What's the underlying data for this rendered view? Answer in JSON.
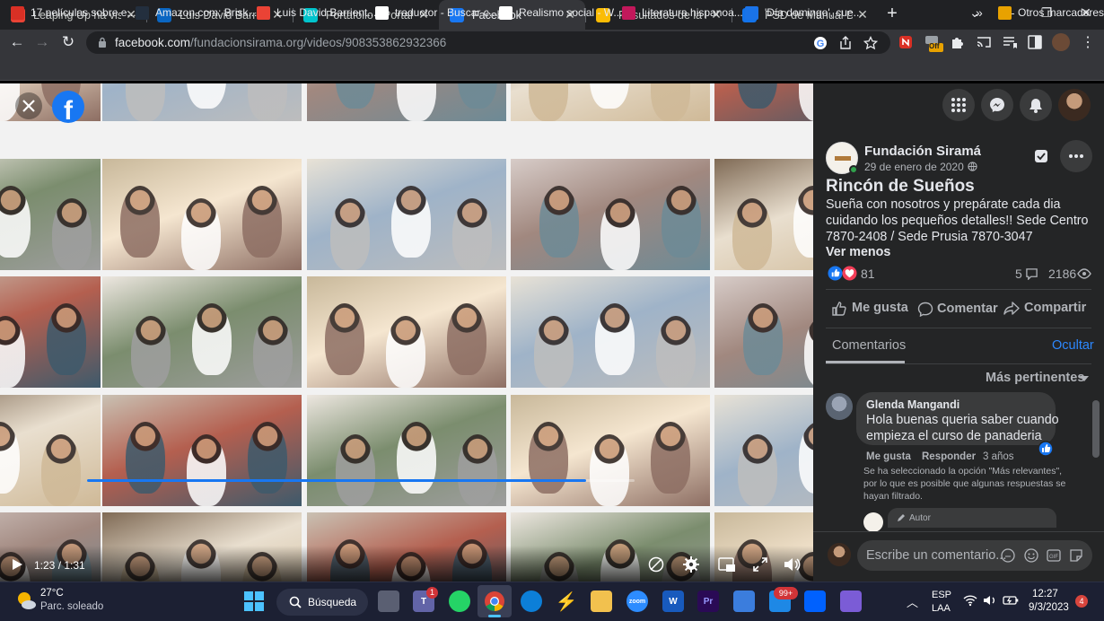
{
  "browser": {
    "tabs": [
      {
        "title": "Leaping Up ha visto tu",
        "favicon": "gmail-icon",
        "color": "#ea4335",
        "active": false
      },
      {
        "title": "Luis David Barrientos",
        "favicon": "linkedin-icon",
        "color": "#0a66c2",
        "active": false
      },
      {
        "title": "Portafolio - Portafolio",
        "favicon": "canva-icon",
        "color": "#00c4cc",
        "active": false
      },
      {
        "title": "Facebook",
        "favicon": "facebook-icon",
        "color": "#1877f2",
        "active": true
      },
      {
        "title": "Resultados de la búsq",
        "favicon": "drive-icon",
        "color": "#fbbc04",
        "active": false
      },
      {
        "title": "PSD de Manual De Ma",
        "favicon": "freepik-icon",
        "color": "#1273eb",
        "active": false
      }
    ],
    "url_host": "facebook.com",
    "url_path": "/fundacionsirama.org/videos/908353862932366",
    "bookmarks": [
      {
        "label": "17 películas sobre e...",
        "icon": "bookmark-red-icon",
        "color": "#d93025"
      },
      {
        "label": "Amazon.com: Brisk...",
        "icon": "amazon-icon",
        "color": "#232f3e"
      },
      {
        "label": "Luis David Barrient...",
        "icon": "gmail-icon",
        "color": "#ea4335"
      },
      {
        "label": "traductor - Buscar c...",
        "icon": "google-icon",
        "color": "#ffffff"
      },
      {
        "label": "Realismo social - W...",
        "icon": "wikipedia-icon",
        "color": "#ffffff"
      },
      {
        "label": "Literatura hispanoa...",
        "icon": "literature-icon",
        "color": "#c2185b"
      },
      {
        "label": "'Día domingo', cue...",
        "icon": "page-icon",
        "color": "#1a73e8"
      }
    ],
    "other_bookmarks": "Otros marcadores",
    "extension_badge": "Off"
  },
  "video": {
    "time": "1:23 / 1:31",
    "progress": 0.912
  },
  "post": {
    "page_name": "Fundación Siramá",
    "date": "29 de enero de 2020 ·",
    "title": "Rincón de Sueños",
    "body_lines": [
      "Sueña con nosotros y prepárate cada dia",
      "cuidando los pequeños detalles!! Sede Centro",
      "7870-2408 / Sede Prusia 7870-3047"
    ],
    "see_less": "Ver menos",
    "reactions_count": "81",
    "comments_count": "5",
    "views_count": "2186",
    "like_label": "Me gusta",
    "comment_label": "Comentar",
    "share_label": "Compartir",
    "comments_tab": "Comentarios",
    "hide_label": "Ocultar",
    "sort_label": "Más pertinentes",
    "comment": {
      "author": "Glenda Mangandi",
      "text_lines": [
        "Hola buenas queria saber cuando",
        "empieza el curso de panaderia"
      ],
      "like": "Me gusta",
      "reply": "Responder",
      "age": "3 años"
    },
    "filter_note_lines": [
      "Se ha seleccionado la opción \"Más relevantes\",",
      "por lo que es posible que algunas respuestas se",
      "hayan filtrado."
    ],
    "author_tag": "Autor",
    "write_placeholder": "Escribe un comentario..."
  },
  "taskbar": {
    "weather_temp": "27°C",
    "weather_desc": "Parc. soleado",
    "search_label": "Búsqueda",
    "teams_badge": "1",
    "mail_badge": "99+",
    "lang_line1": "ESP",
    "lang_line2": "LAA",
    "time": "12:27",
    "date": "9/3/2023",
    "notif_count": "4"
  }
}
